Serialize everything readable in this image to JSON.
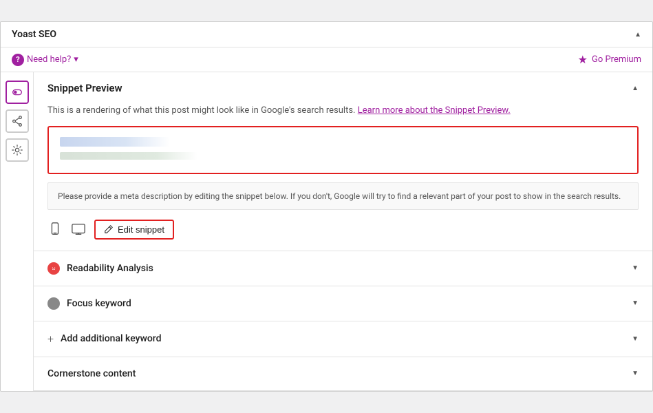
{
  "header": {
    "title": "Yoast SEO",
    "collapse_icon": "▲"
  },
  "topbar": {
    "need_help": "Need help?",
    "chevron": "▾",
    "go_premium": "Go Premium"
  },
  "sidebar": {
    "items": [
      {
        "id": "toggle",
        "icon": "toggle",
        "label": "Toggle icon"
      },
      {
        "id": "share",
        "icon": "share",
        "label": "Share icon"
      },
      {
        "id": "settings",
        "icon": "settings",
        "label": "Settings icon"
      }
    ]
  },
  "snippet_preview": {
    "section_title": "Snippet Preview",
    "collapse_icon": "▲",
    "description": "This is a rendering of what this post might look like in Google's search results.",
    "learn_more_link": "Learn more about the Snippet Preview.",
    "meta_notice": "Please provide a meta description by editing the snippet below. If you don't, Google will try to find a relevant part of your post to show in the search results.",
    "edit_snippet_label": "Edit snippet"
  },
  "collapsible_sections": [
    {
      "id": "readability",
      "label": "Readability Analysis",
      "status": "red",
      "collapse_icon": "▼"
    },
    {
      "id": "focus-keyword",
      "label": "Focus keyword",
      "status": "gray",
      "collapse_icon": "▼"
    },
    {
      "id": "additional-keyword",
      "label": "Add additional keyword",
      "status": "plus",
      "collapse_icon": "▼"
    },
    {
      "id": "cornerstone",
      "label": "Cornerstone content",
      "status": "none",
      "collapse_icon": "▼"
    }
  ]
}
